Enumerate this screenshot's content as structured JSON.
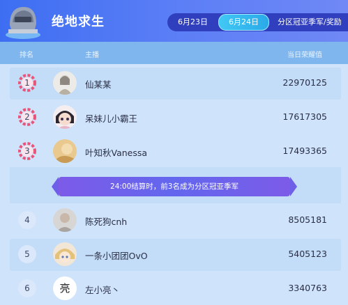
{
  "header": {
    "title": "绝地求生",
    "tabs": [
      {
        "label": "6月23日",
        "active": false
      },
      {
        "label": "6月24日",
        "active": true
      },
      {
        "label": "分区冠亚季军/奖励",
        "active": false
      }
    ]
  },
  "columns": {
    "rank": "排名",
    "streamer": "主播",
    "score": "当日荣耀值"
  },
  "rows": [
    {
      "rank": "1",
      "name": "仙某某",
      "score": "22970125",
      "top": true
    },
    {
      "rank": "2",
      "name": "呆妹儿小霸王",
      "score": "17617305",
      "top": true
    },
    {
      "rank": "3",
      "name": "叶知秋Vanessa",
      "score": "17493365",
      "top": true
    },
    {
      "rank": "4",
      "name": "陈死狗cnh",
      "score": "8505181",
      "top": false
    },
    {
      "rank": "5",
      "name": "一条小团团OvO",
      "score": "5405123",
      "top": false
    },
    {
      "rank": "6",
      "name": "左小亮丶",
      "score": "3340763",
      "top": false
    }
  ],
  "banner": {
    "text": "24:00结算时，前3名成为分区冠亚季军"
  },
  "avatar_glyph_6": "亮",
  "colors": {
    "header": "#3d6ef2",
    "accent": "#41c8f5",
    "row_alt": "#c3dcf8",
    "rank_ring": "#e8557a"
  }
}
